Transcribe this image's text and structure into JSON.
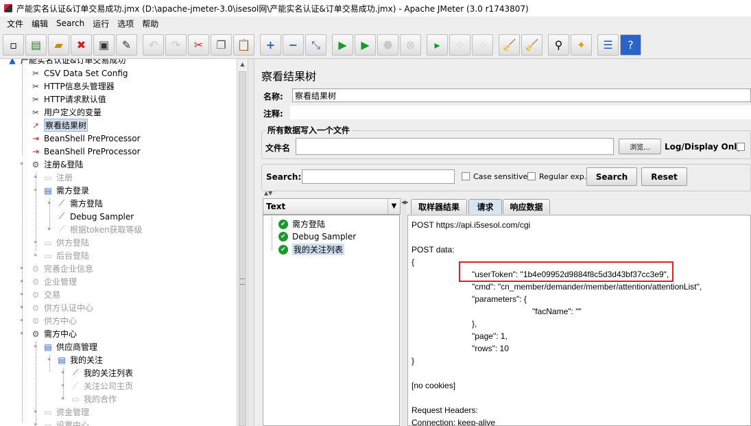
{
  "window": {
    "title": "产能实名认证&订单交易成功.jmx (D:\\apache-jmeter-3.0\\isesol网\\产能实名认证&订单交易成功.jmx) - Apache JMeter (3.0 r1743807)"
  },
  "menu": [
    "文件",
    "编辑",
    "Search",
    "运行",
    "选项",
    "帮助"
  ],
  "tree": {
    "root_label": "产能实名认证&订单交易成功",
    "items": [
      {
        "label": "CSV Data Set Config",
        "icon": "scissors-icon",
        "disabled": false
      },
      {
        "label": "HTTP信息头管理器",
        "icon": "scissors-icon",
        "disabled": false
      },
      {
        "label": "HTTP请求默认值",
        "icon": "scissors-icon",
        "disabled": false
      },
      {
        "label": "用户定义的变量",
        "icon": "scissors-icon",
        "disabled": false
      },
      {
        "label": "察看结果树",
        "icon": "chart-icon",
        "disabled": false,
        "selected": true
      },
      {
        "label": "BeanShell PreProcessor",
        "icon": "preprocessor-icon",
        "disabled": false
      },
      {
        "label": "BeanShell PreProcessor",
        "icon": "preprocessor-icon",
        "disabled": false
      },
      {
        "label": "注册&登陆",
        "icon": "gear-icon",
        "disabled": false
      },
      {
        "label": "注册",
        "icon": "box-icon",
        "disabled": true
      },
      {
        "label": "需方登录",
        "icon": "controller-icon",
        "disabled": false
      },
      {
        "label": "需方登陆",
        "icon": "pipette-icon",
        "disabled": false
      },
      {
        "label": "Debug Sampler",
        "icon": "pipette-icon",
        "disabled": false
      },
      {
        "label": "根据token获取等级",
        "icon": "pipette-icon",
        "disabled": true
      },
      {
        "label": "供方登陆",
        "icon": "box-icon",
        "disabled": true
      },
      {
        "label": "后台登陆",
        "icon": "box-icon",
        "disabled": true
      },
      {
        "label": "完善企业信息",
        "icon": "gear-icon",
        "disabled": true
      },
      {
        "label": "企业管理",
        "icon": "gear-icon",
        "disabled": true
      },
      {
        "label": "交易",
        "icon": "gear-icon",
        "disabled": true
      },
      {
        "label": "供方认证中心",
        "icon": "gear-icon",
        "disabled": true
      },
      {
        "label": "供方中心",
        "icon": "gear-icon",
        "disabled": true
      },
      {
        "label": "需方中心",
        "icon": "gear-icon",
        "disabled": false
      },
      {
        "label": "供应商管理",
        "icon": "controller-icon",
        "disabled": false
      },
      {
        "label": "我的关注",
        "icon": "controller-icon",
        "disabled": false
      },
      {
        "label": "我的关注列表",
        "icon": "pipette-icon",
        "disabled": false
      },
      {
        "label": "关注公司主页",
        "icon": "pipette-icon",
        "disabled": true
      },
      {
        "label": "我的合作",
        "icon": "box-icon",
        "disabled": true
      },
      {
        "label": "资金管理",
        "icon": "box-icon",
        "disabled": true
      },
      {
        "label": "设置中心",
        "icon": "box-icon",
        "disabled": true
      }
    ]
  },
  "panel": {
    "title": "察看结果树",
    "name_label": "名称:",
    "name_value": "察看结果树",
    "comment_label": "注释:",
    "file_group_title": "所有数据写入一个文件",
    "filename_label": "文件名",
    "browse_button": "浏览...",
    "log_display_label": "Log/Display Only:",
    "search_label": "Search:",
    "case_sensitive_label": "Case sensitive",
    "regular_exp_label": "Regular exp.",
    "search_button": "Search",
    "reset_button": "Reset"
  },
  "results": {
    "renderer": "Text",
    "items": [
      {
        "label": "需方登陆",
        "status": "success"
      },
      {
        "label": "Debug Sampler",
        "status": "success"
      },
      {
        "label": "我的关注列表",
        "status": "success",
        "selected": true
      }
    ]
  },
  "tabs": [
    {
      "label": "取样器结果",
      "active": false
    },
    {
      "label": "请求",
      "active": true
    },
    {
      "label": "响应数据",
      "active": false
    }
  ],
  "request": {
    "lines": [
      "POST https://api.i5sesol.com/cgi",
      "",
      "POST data:",
      "{",
      "\"userToken\": \"1b4e09952d9884f8c5d3d43bf37cc3e9\",",
      "\"cmd\": \"cn_member/demander/member/attention/attentionList\",",
      "\"parameters\": {",
      "\"facName\": \"\"",
      "},",
      "\"page\": 1,",
      "\"rows\": 10",
      "}",
      "",
      "[no cookies]",
      "",
      "Request Headers:",
      "Connection: keep-alive"
    ]
  }
}
